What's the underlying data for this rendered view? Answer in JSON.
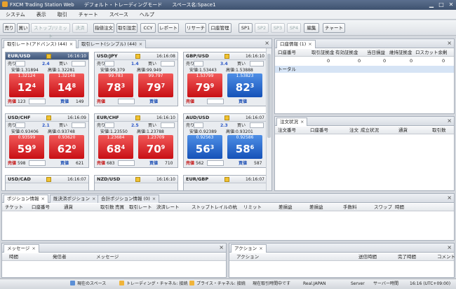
{
  "title_bar": {
    "app": "FXCM Trading Station Web",
    "mode": "デフォルト・トレーディングモード",
    "space": "スペース名:Space1"
  },
  "menu": [
    "システム",
    "表示",
    "取引",
    "チャート",
    "スペース",
    "ヘルプ"
  ],
  "toolbar": [
    "売り",
    "買い",
    "ストップ/リミット",
    "決済",
    "指値注文",
    "取引設定",
    "CCY",
    "レポート",
    "リサーチ",
    "口座管理",
    "SP1",
    "SP2",
    "SP3",
    "SP4",
    "編集",
    "チャート"
  ],
  "rates_panel": {
    "tabs": [
      "取引レート(アドバンス) (44)",
      "取引レート(シンプル) (44)"
    ],
    "cards": [
      {
        "symbol": "EUR/USD",
        "time": "16:16:10",
        "sell_label": "売り",
        "buy_label": "買い",
        "spread": "2.4",
        "low": "安値:1.31894",
        "high": "高値:1.32281",
        "sell_small": "1.32124",
        "sell_big": "12",
        "sell_pip": "4",
        "buy_small": "1.32148",
        "buy_big": "14",
        "buy_pip": "8",
        "qty1": "123",
        "qty2": "149",
        "sell_btn": "売値",
        "buy_btn": "買値",
        "sell_color": "red",
        "buy_color": "red"
      },
      {
        "symbol": "USD/JPY",
        "time": "16:16:08",
        "sell_label": "売り",
        "buy_label": "買い",
        "spread": "1.4",
        "low": "安値:99.379",
        "high": "高値:99.949",
        "sell_small": "99.783",
        "sell_big": "78",
        "sell_pip": "3",
        "buy_small": "99.797",
        "buy_big": "79",
        "buy_pip": "7",
        "qty1": "",
        "qty2": "",
        "sell_btn": "売値",
        "buy_btn": "買値",
        "sell_color": "red",
        "buy_color": "red"
      },
      {
        "symbol": "GBP/USD",
        "time": "16:16:10",
        "sell_label": "売り",
        "buy_label": "買い",
        "spread": "3.4",
        "low": "安値:1.53443",
        "high": "高値:1.53888",
        "sell_small": "1.53799",
        "sell_big": "79",
        "sell_pip": "9",
        "buy_small": "1.53823",
        "buy_big": "82",
        "buy_pip": "3",
        "qty1": "",
        "qty2": "",
        "sell_btn": "売値",
        "buy_btn": "買値",
        "sell_color": "red",
        "buy_color": "blue"
      },
      {
        "symbol": "USD/CHF",
        "time": "16:16:09",
        "sell_label": "売り",
        "buy_label": "買い",
        "spread": "2.1",
        "low": "安値:0.93406",
        "high": "高値:0.93748",
        "sell_small": "0.93599",
        "sell_big": "59",
        "sell_pip": "9",
        "buy_small": "0.93620",
        "buy_big": "62",
        "buy_pip": "0",
        "qty1": "598",
        "qty2": "621",
        "sell_btn": "売値",
        "buy_btn": "買値",
        "sell_color": "red",
        "buy_color": "red"
      },
      {
        "symbol": "EUR/CHF",
        "time": "16:16:10",
        "sell_label": "売り",
        "buy_label": "買い",
        "spread": "2.5",
        "low": "安値:1.23550",
        "high": "高値:1.23788",
        "sell_small": "1.23684",
        "sell_big": "68",
        "sell_pip": "4",
        "buy_small": "1.23709",
        "buy_big": "70",
        "buy_pip": "9",
        "qty1": "683",
        "qty2": "710",
        "sell_btn": "売値",
        "buy_btn": "買値",
        "sell_color": "red",
        "buy_color": "red"
      },
      {
        "symbol": "AUD/USD",
        "time": "16:16:07",
        "sell_label": "売り",
        "buy_label": "買い",
        "spread": "2.3",
        "low": "安値:0.92389",
        "high": "高値:0.93201",
        "sell_small": "0.92563",
        "sell_big": "56",
        "sell_pip": "3",
        "buy_small": "0.92586",
        "buy_big": "58",
        "buy_pip": "6",
        "qty1": "562",
        "qty2": "587",
        "sell_btn": "売値",
        "buy_btn": "買値",
        "sell_color": "blue",
        "buy_color": "blue"
      }
    ],
    "partial_cards": [
      {
        "symbol": "USD/CAD",
        "time": "16:16:07"
      },
      {
        "symbol": "NZD/USD",
        "time": "16:16:10"
      },
      {
        "symbol": "EUR/GBP",
        "time": "16:16:07"
      }
    ]
  },
  "account_panel": {
    "tab": "口座情報 (1)",
    "columns": [
      "口座番号",
      "取引証拠金",
      "有効証拠金",
      "当日損益",
      "維持証拠金",
      "ロスカット余剰"
    ],
    "row": {
      "label": "トータル",
      "values": [
        "0",
        "0",
        "0",
        "0",
        "0"
      ]
    }
  },
  "orders_panel": {
    "tab": "注文状況",
    "columns": [
      "注文番号",
      "口座番号",
      "注文",
      "成立状況",
      "通貨",
      "取引数"
    ]
  },
  "positions_panel": {
    "tabs": [
      "ポジション情報",
      "既決済ポジション",
      "合計ポジション情報 (0)"
    ],
    "columns": [
      "チケット",
      "口座番号",
      "通貨",
      "取引数",
      "売買",
      "取引レート",
      "決済レート",
      "ストップ",
      "トレイルの杭",
      "リミット",
      "差損益",
      "差損益",
      "手数料",
      "スワップ",
      "時間"
    ]
  },
  "messages_panel": {
    "tab": "メッセージ",
    "columns": [
      "時間",
      "発信者",
      "メッセージ"
    ]
  },
  "actions_panel": {
    "tab": "アクション",
    "columns": [
      "アクション",
      "送信時間",
      "完了時間",
      "コメント"
    ]
  },
  "status_bar": {
    "space": "現在のスペース",
    "trade_channel": "トレーディング・チャネル: 接続",
    "price_channel": "プライス・チャネル: 接続",
    "recv": "現在取引時間中です",
    "server_name": "Real.JAPAN",
    "server_label": "Server",
    "server_time_label": "サーバー時間",
    "time": "16:16 (UTC+09:00)"
  }
}
